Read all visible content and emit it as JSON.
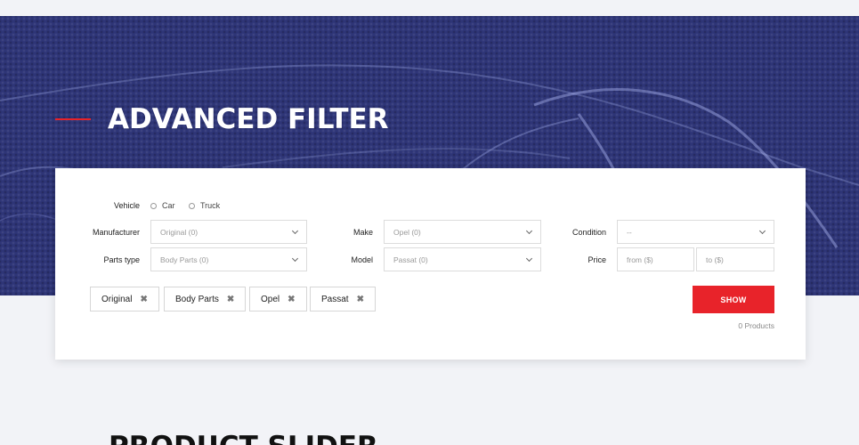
{
  "hero": {
    "title": "ADVANCED FILTER"
  },
  "filter": {
    "vehicle": {
      "label": "Vehicle",
      "options": [
        "Car",
        "Truck"
      ]
    },
    "manufacturer": {
      "label": "Manufacturer",
      "value": "Original (0)"
    },
    "make": {
      "label": "Make",
      "value": "Opel (0)"
    },
    "condition": {
      "label": "Condition",
      "value": "--"
    },
    "parts_type": {
      "label": "Parts type",
      "value": "Body Parts (0)"
    },
    "model": {
      "label": "Model",
      "value": "Passat (0)"
    },
    "price": {
      "label": "Price",
      "from_placeholder": "from ($)",
      "to_placeholder": "to ($)"
    },
    "tags": [
      "Original",
      "Body Parts",
      "Opel",
      "Passat"
    ],
    "tag_remove_glyph": "✖",
    "show_label": "SHOW",
    "count_text": "0 Products"
  },
  "next_section": {
    "title": "PRODUCT SLIDER"
  },
  "colors": {
    "hero_bg": "#2e3577",
    "accent": "#e8232a",
    "page_bg": "#f2f3f7"
  }
}
